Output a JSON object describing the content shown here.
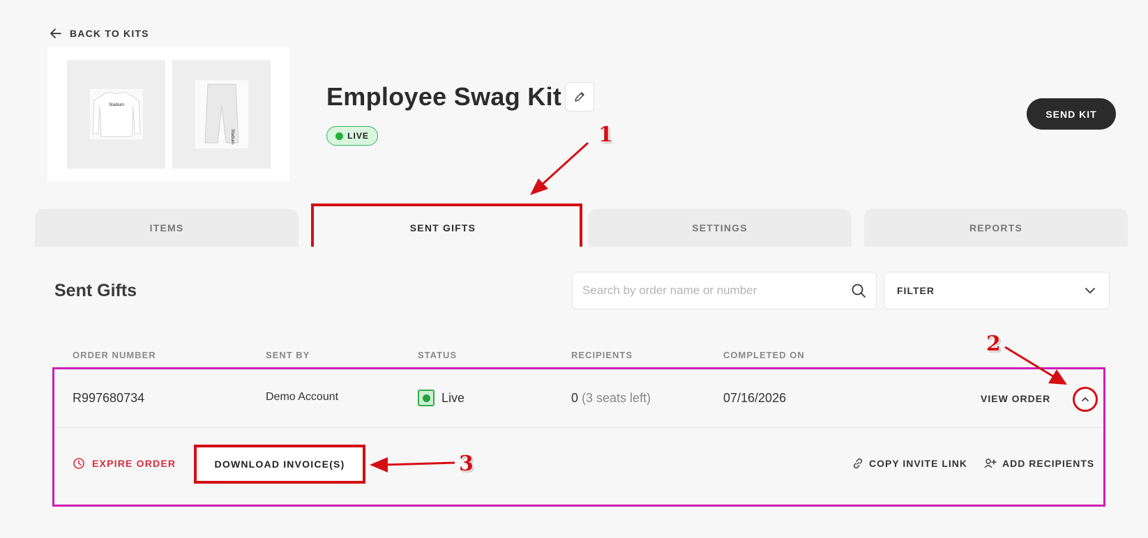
{
  "nav": {
    "back_label": "BACK TO KITS"
  },
  "kit": {
    "title": "Employee Swag Kit",
    "status_badge": "LIVE",
    "send_button": "SEND KIT",
    "thumb_brand": "Stadium"
  },
  "tabs": [
    {
      "label": "ITEMS"
    },
    {
      "label": "SENT GIFTS"
    },
    {
      "label": "SETTINGS"
    },
    {
      "label": "REPORTS"
    }
  ],
  "sent_gifts": {
    "title": "Sent Gifts",
    "search_placeholder": "Search by order name or number",
    "filter_label": "FILTER",
    "columns": [
      "ORDER NUMBER",
      "SENT BY",
      "STATUS",
      "RECIPIENTS",
      "COMPLETED ON"
    ],
    "row": {
      "order_number": "R997680734",
      "sent_by": "Demo Account",
      "status": "Live",
      "recipients_count": "0",
      "recipients_note": "(3 seats left)",
      "completed_on": "07/16/2026",
      "view_order": "VIEW ORDER"
    },
    "actions": {
      "expire": "EXPIRE ORDER",
      "download": "DOWNLOAD INVOICE(S)",
      "copy_link": "COPY INVITE LINK",
      "add_recipients": "ADD RECIPIENTS"
    }
  },
  "annotations": [
    "1",
    "2",
    "3"
  ],
  "colors": {
    "annotation_red": "#d40f14",
    "row_highlight": "#cc1fb6",
    "live_green": "#22b13c",
    "dark_button": "#2b2b2b"
  }
}
